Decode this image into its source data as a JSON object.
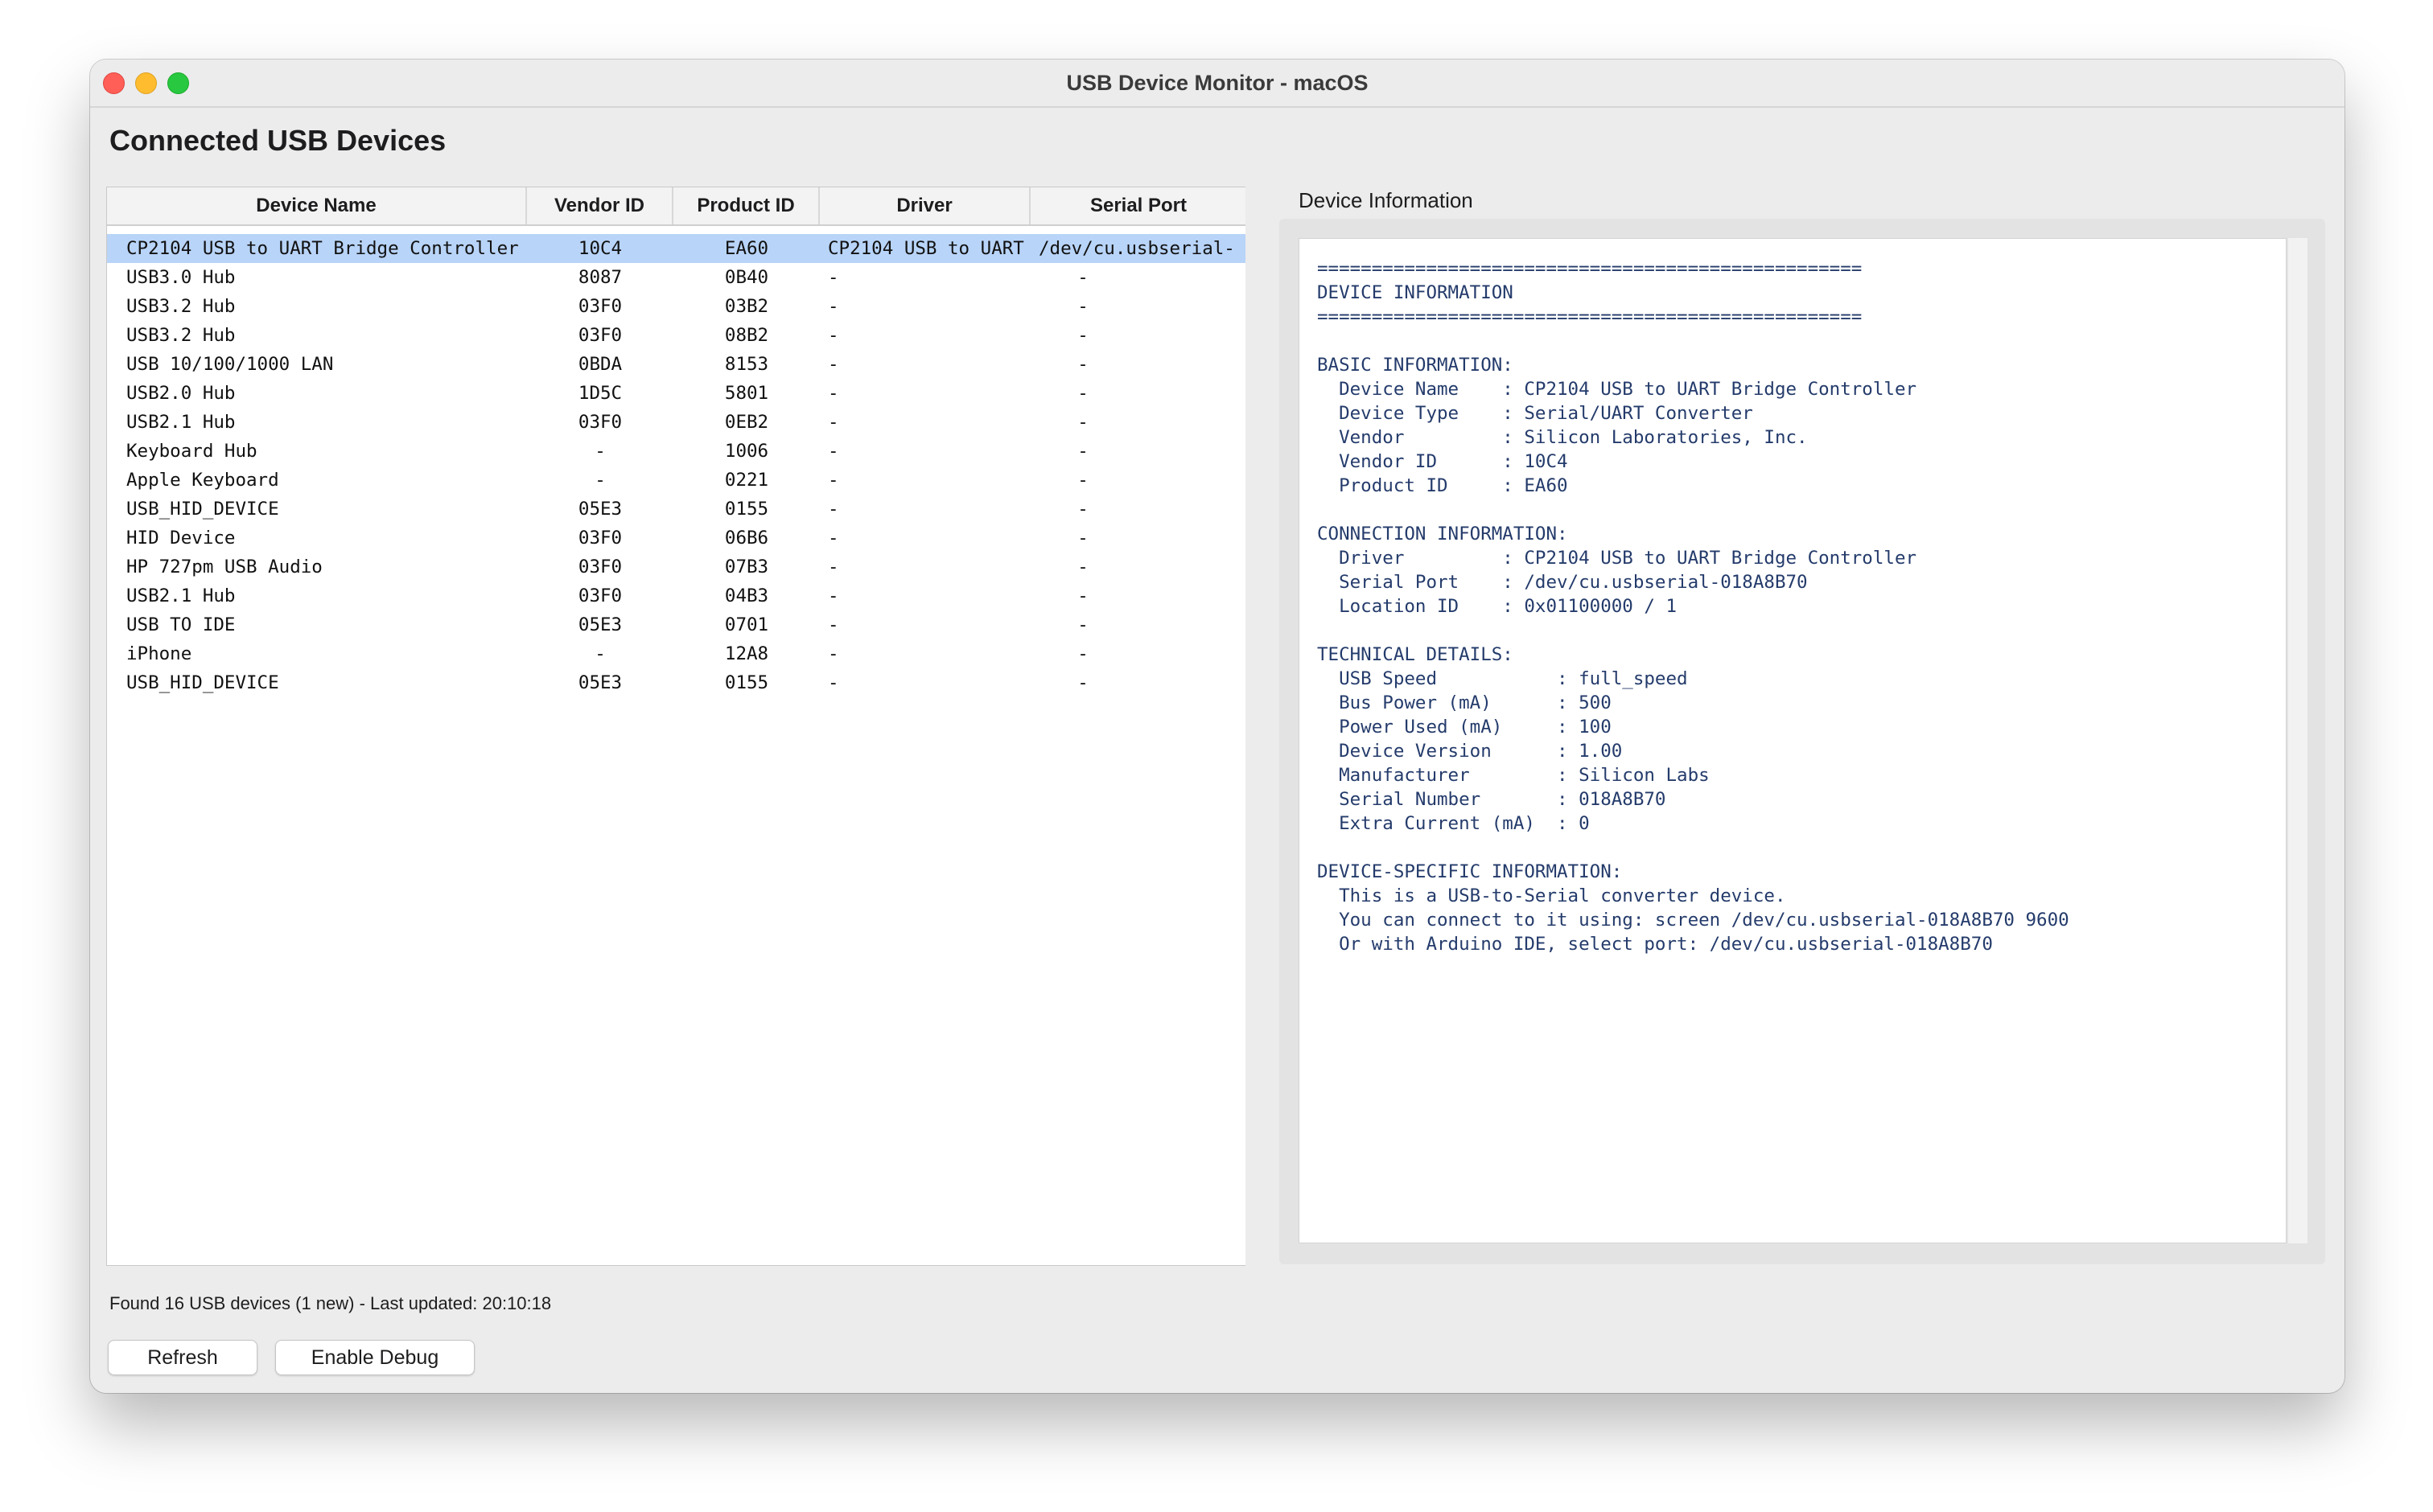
{
  "window": {
    "title": "USB Device Monitor - macOS"
  },
  "heading": "Connected USB Devices",
  "table": {
    "headers": [
      "Device Name",
      "Vendor ID",
      "Product ID",
      "Driver",
      "Serial Port"
    ],
    "rows": [
      [
        "CP2104 USB to UART Bridge Controller",
        "10C4",
        "EA60",
        "CP2104 USB to UART",
        "/dev/cu.usbserial-"
      ],
      [
        "USB3.0 Hub",
        "8087",
        "0B40",
        "-",
        "-"
      ],
      [
        "USB3.2 Hub",
        "03F0",
        "03B2",
        "-",
        "-"
      ],
      [
        "USB3.2 Hub",
        "03F0",
        "08B2",
        "-",
        "-"
      ],
      [
        "USB 10/100/1000 LAN",
        "0BDA",
        "8153",
        "-",
        "-"
      ],
      [
        "USB2.0 Hub",
        "1D5C",
        "5801",
        "-",
        "-"
      ],
      [
        "USB2.1 Hub",
        "03F0",
        "0EB2",
        "-",
        "-"
      ],
      [
        "Keyboard Hub",
        "-",
        "1006",
        "-",
        "-"
      ],
      [
        "Apple Keyboard",
        "-",
        "0221",
        "-",
        "-"
      ],
      [
        "USB_HID_DEVICE",
        "05E3",
        "0155",
        "-",
        "-"
      ],
      [
        "HID Device",
        "03F0",
        "06B6",
        "-",
        "-"
      ],
      [
        "HP 727pm USB Audio",
        "03F0",
        "07B3",
        "-",
        "-"
      ],
      [
        "USB2.1 Hub",
        "03F0",
        "04B3",
        "-",
        "-"
      ],
      [
        "USB TO IDE",
        "05E3",
        "0701",
        "-",
        "-"
      ],
      [
        "iPhone",
        "-",
        "12A8",
        "-",
        "-"
      ],
      [
        "USB_HID_DEVICE",
        "05E3",
        "0155",
        "-",
        "-"
      ]
    ]
  },
  "info_panel": {
    "label": "Device Information",
    "text": "==================================================\nDEVICE INFORMATION\n==================================================\n\nBASIC INFORMATION:\n  Device Name    : CP2104 USB to UART Bridge Controller\n  Device Type    : Serial/UART Converter\n  Vendor         : Silicon Laboratories, Inc.\n  Vendor ID      : 10C4\n  Product ID     : EA60\n\nCONNECTION INFORMATION:\n  Driver         : CP2104 USB to UART Bridge Controller\n  Serial Port    : /dev/cu.usbserial-018A8B70\n  Location ID    : 0x01100000 / 1\n\nTECHNICAL DETAILS:\n  USB Speed           : full_speed\n  Bus Power (mA)      : 500\n  Power Used (mA)     : 100\n  Device Version      : 1.00\n  Manufacturer        : Silicon Labs\n  Serial Number       : 018A8B70\n  Extra Current (mA)  : 0\n\nDEVICE-SPECIFIC INFORMATION:\n  This is a USB-to-Serial converter device.\n  You can connect to it using: screen /dev/cu.usbserial-018A8B70 9600\n  Or with Arduino IDE, select port: /dev/cu.usbserial-018A8B70"
  },
  "status": "Found 16 USB devices (1 new) - Last updated: 20:10:18",
  "buttons": {
    "refresh": "Refresh",
    "debug": "Enable Debug"
  },
  "colors": {
    "selection": "#b8d4f8",
    "info_text": "#243b6b"
  }
}
